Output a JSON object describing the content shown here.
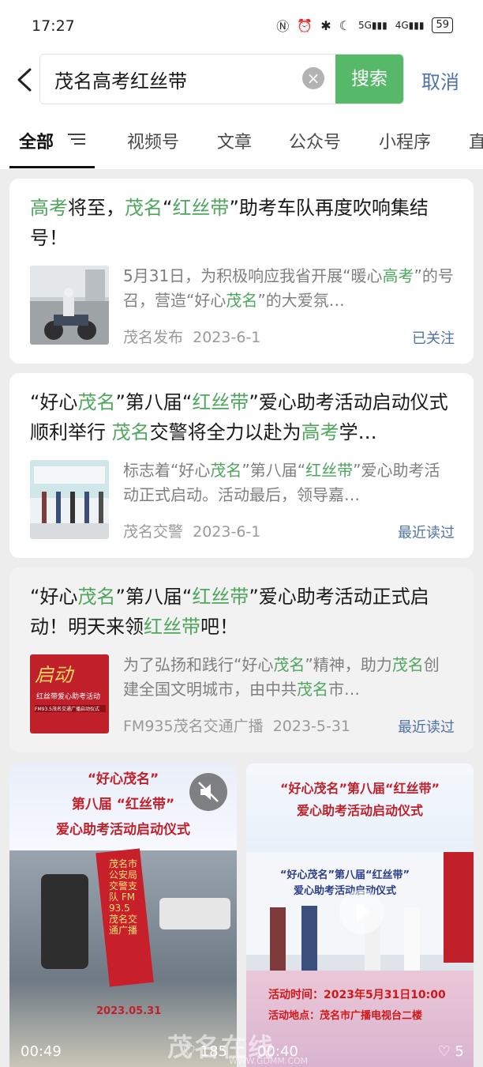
{
  "status_bar": {
    "time": "17:27",
    "battery": "59",
    "net1": "5G",
    "net2": "4G"
  },
  "search": {
    "query": "茂名高考红丝带",
    "button": "搜索",
    "cancel": "取消"
  },
  "tabs": [
    "全部",
    "视频号",
    "文章",
    "公众号",
    "小程序",
    "直"
  ],
  "articles": [
    {
      "title_parts": [
        {
          "t": "高考",
          "hl": true
        },
        {
          "t": "将至，",
          "hl": false
        },
        {
          "t": "茂名",
          "hl": true
        },
        {
          "t": "“",
          "hl": false
        },
        {
          "t": "红丝带",
          "hl": true
        },
        {
          "t": "”助考车队再度吹响集结号！",
          "hl": false
        }
      ],
      "desc_parts": [
        {
          "t": "5月31日，为积极响应我省开展“暖心",
          "hl": false
        },
        {
          "t": "高考",
          "hl": true
        },
        {
          "t": "”的号召，营造“好心",
          "hl": false
        },
        {
          "t": "茂名",
          "hl": true
        },
        {
          "t": "”的大爱氛…",
          "hl": false
        }
      ],
      "source": "茂名发布",
      "date": "2023-6-1",
      "status": "已关注"
    },
    {
      "title_parts": [
        {
          "t": "“好心",
          "hl": false
        },
        {
          "t": "茂名",
          "hl": true
        },
        {
          "t": "”第八届“",
          "hl": false
        },
        {
          "t": "红丝带",
          "hl": true
        },
        {
          "t": "”爱心助考活动启动仪式顺利举行 ",
          "hl": false
        },
        {
          "t": "茂名",
          "hl": true
        },
        {
          "t": "交警将全力以赴为",
          "hl": false
        },
        {
          "t": "高考",
          "hl": true
        },
        {
          "t": "学…",
          "hl": false
        }
      ],
      "desc_parts": [
        {
          "t": "标志着“好心",
          "hl": false
        },
        {
          "t": "茂名",
          "hl": true
        },
        {
          "t": "”第八届“",
          "hl": false
        },
        {
          "t": "红丝带",
          "hl": true
        },
        {
          "t": "”爱心助考活动正式启动。活动最后，领导嘉…",
          "hl": false
        }
      ],
      "source": "茂名交警",
      "date": "2023-6-1",
      "status": "最近读过"
    },
    {
      "title_parts": [
        {
          "t": "“好心",
          "hl": false
        },
        {
          "t": "茂名",
          "hl": true
        },
        {
          "t": "”第八届“",
          "hl": false
        },
        {
          "t": "红丝带",
          "hl": true
        },
        {
          "t": "”爱心助考活动正式启动！明天来领",
          "hl": false
        },
        {
          "t": "红丝带",
          "hl": true
        },
        {
          "t": "吧！",
          "hl": false
        }
      ],
      "desc_parts": [
        {
          "t": "为了弘扬和践行“好心",
          "hl": false
        },
        {
          "t": "茂名",
          "hl": true
        },
        {
          "t": "”精神，助力",
          "hl": false
        },
        {
          "t": "茂名",
          "hl": true
        },
        {
          "t": "创建全国文明城市，由中共",
          "hl": false
        },
        {
          "t": "茂名",
          "hl": true
        },
        {
          "t": "市…",
          "hl": false
        }
      ],
      "source": "FM935茂名交通广播",
      "date": "2023-5-31",
      "status": "最近读过"
    }
  ],
  "thumb3": {
    "big": "启动",
    "line": "红丝带爱心助考活动",
    "small": "FM93.5茂名交通广播启动仪式"
  },
  "videos": [
    {
      "banner_lines": [
        "“好心茂名”",
        "第八届 “红丝带”",
        "爱心助考活动启动仪式"
      ],
      "ribbon_text": "茂名市公安局交警支队 FM93.5 茂名交通广播",
      "date_overlay": "2023.05.31",
      "duration": "00:49",
      "likes": "185"
    },
    {
      "banner_lines": [
        "“好心茂名”第八届“红丝带”",
        "爱心助考活动启动仪式"
      ],
      "stage_lines": [
        "“好心茂名”第八届“红丝带”",
        "爱心助考活动启动仪式"
      ],
      "info_time": "活动时间：2023年5月31日10:00",
      "info_place": "活动地点：茂名市广播电视台二楼",
      "duration": "00:40",
      "likes": "5"
    }
  ],
  "watermark": {
    "main": "茂名在线",
    "url": "WWW.GDMM.COM"
  },
  "colors": {
    "accent": "#56b96a",
    "highlight": "#4fa65d",
    "link": "#4f72a8"
  }
}
